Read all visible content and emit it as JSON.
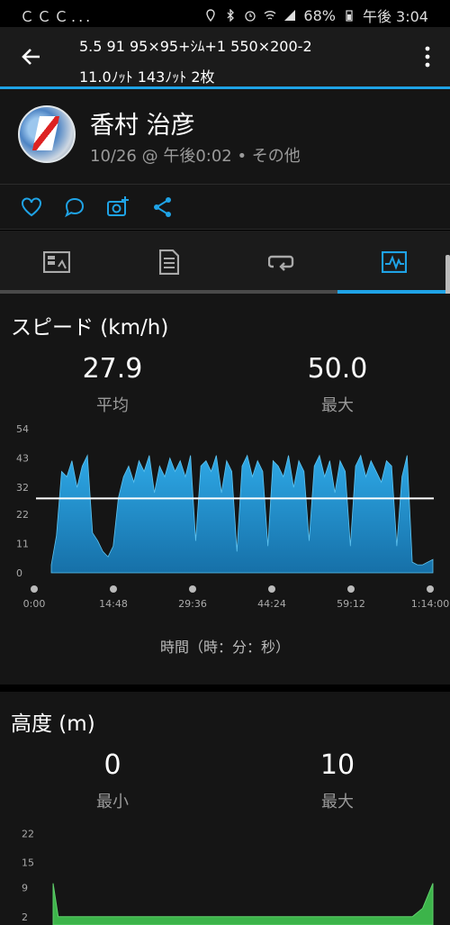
{
  "status_bar": {
    "left_icons": "ＣＣＣ...",
    "battery": "68%",
    "time": "午後 3:04",
    "icons": [
      "location-icon",
      "bluetooth-icon",
      "alarm-icon",
      "volte-icon",
      "wifi-icon",
      "signal-icon",
      "battery-icon"
    ]
  },
  "appbar": {
    "title_line1": "5.5 91 95×95+ｼﾑ+1 550×200-2",
    "title_line2": "11.0ﾉｯﾄ 143ﾉｯﾄ 2枚"
  },
  "profile": {
    "name": "香村 治彦",
    "meta": "10/26 @ 午後0:02 • その他"
  },
  "actions": [
    "like-icon",
    "comment-icon",
    "add-photo-icon",
    "share-icon"
  ],
  "tabs": [
    {
      "icon": "overview-icon",
      "active": false
    },
    {
      "icon": "details-icon",
      "active": false
    },
    {
      "icon": "laps-icon",
      "active": false
    },
    {
      "icon": "charts-icon",
      "active": true
    }
  ],
  "colors": {
    "accent": "#1fa3e6",
    "background": "#151515"
  },
  "speed": {
    "title": "スピード (km/h)",
    "avg_value": "27.9",
    "avg_label": "平均",
    "max_value": "50.0",
    "max_label": "最大",
    "x_axis_label": "時間（時：分：秒）"
  },
  "altitude": {
    "title": "高度 (m)",
    "min_value": "0",
    "min_label": "最小",
    "max_value": "10",
    "max_label": "最大"
  },
  "chart_data": [
    {
      "type": "area",
      "title": "スピード (km/h)",
      "xlabel": "時間（時：分：秒）",
      "ylabel": "",
      "x_ticks": [
        "0:00",
        "14:48",
        "29:36",
        "44:24",
        "59:12",
        "1:14:00"
      ],
      "y_ticks": [
        0,
        11,
        22,
        32,
        43,
        54
      ],
      "ylim": [
        0,
        54
      ],
      "average_line": 27.9,
      "series": [
        {
          "x_minutes": [
            0,
            1,
            2,
            3,
            4,
            5,
            6,
            7,
            8,
            9,
            10,
            11,
            12,
            13,
            14,
            15,
            16,
            17,
            18,
            19,
            20,
            21,
            22,
            23,
            24,
            25,
            26,
            27,
            28,
            29,
            30,
            31,
            32,
            33,
            34,
            35,
            36,
            37,
            38,
            39,
            40,
            41,
            42,
            43,
            44,
            45,
            46,
            47,
            48,
            49,
            50,
            51,
            52,
            53,
            54,
            55,
            56,
            57,
            58,
            59,
            60,
            61,
            62,
            63,
            64,
            65,
            66,
            67,
            68,
            69,
            70,
            71,
            72,
            73,
            74
          ],
          "values": [
            3,
            14,
            38,
            36,
            42,
            32,
            40,
            44,
            15,
            12,
            8,
            6,
            10,
            28,
            36,
            40,
            34,
            42,
            38,
            44,
            30,
            40,
            36,
            43,
            38,
            42,
            36,
            44,
            12,
            40,
            42,
            38,
            44,
            30,
            42,
            38,
            8,
            40,
            44,
            36,
            42,
            38,
            10,
            42,
            40,
            36,
            44,
            32,
            42,
            38,
            12,
            40,
            44,
            36,
            42,
            30,
            42,
            38,
            10,
            40,
            44,
            36,
            42,
            38,
            34,
            42,
            40,
            10,
            36,
            44,
            4,
            3,
            3,
            4,
            5
          ]
        }
      ],
      "grid": false
    },
    {
      "type": "area",
      "title": "高度 (m)",
      "y_ticks": [
        2,
        9,
        15,
        22
      ],
      "series": [
        {
          "x_minutes": [
            0,
            1,
            2,
            60,
            70,
            72,
            73,
            74
          ],
          "values": [
            10,
            2,
            2,
            2,
            2,
            4,
            7,
            10
          ]
        }
      ],
      "grid": false
    }
  ]
}
